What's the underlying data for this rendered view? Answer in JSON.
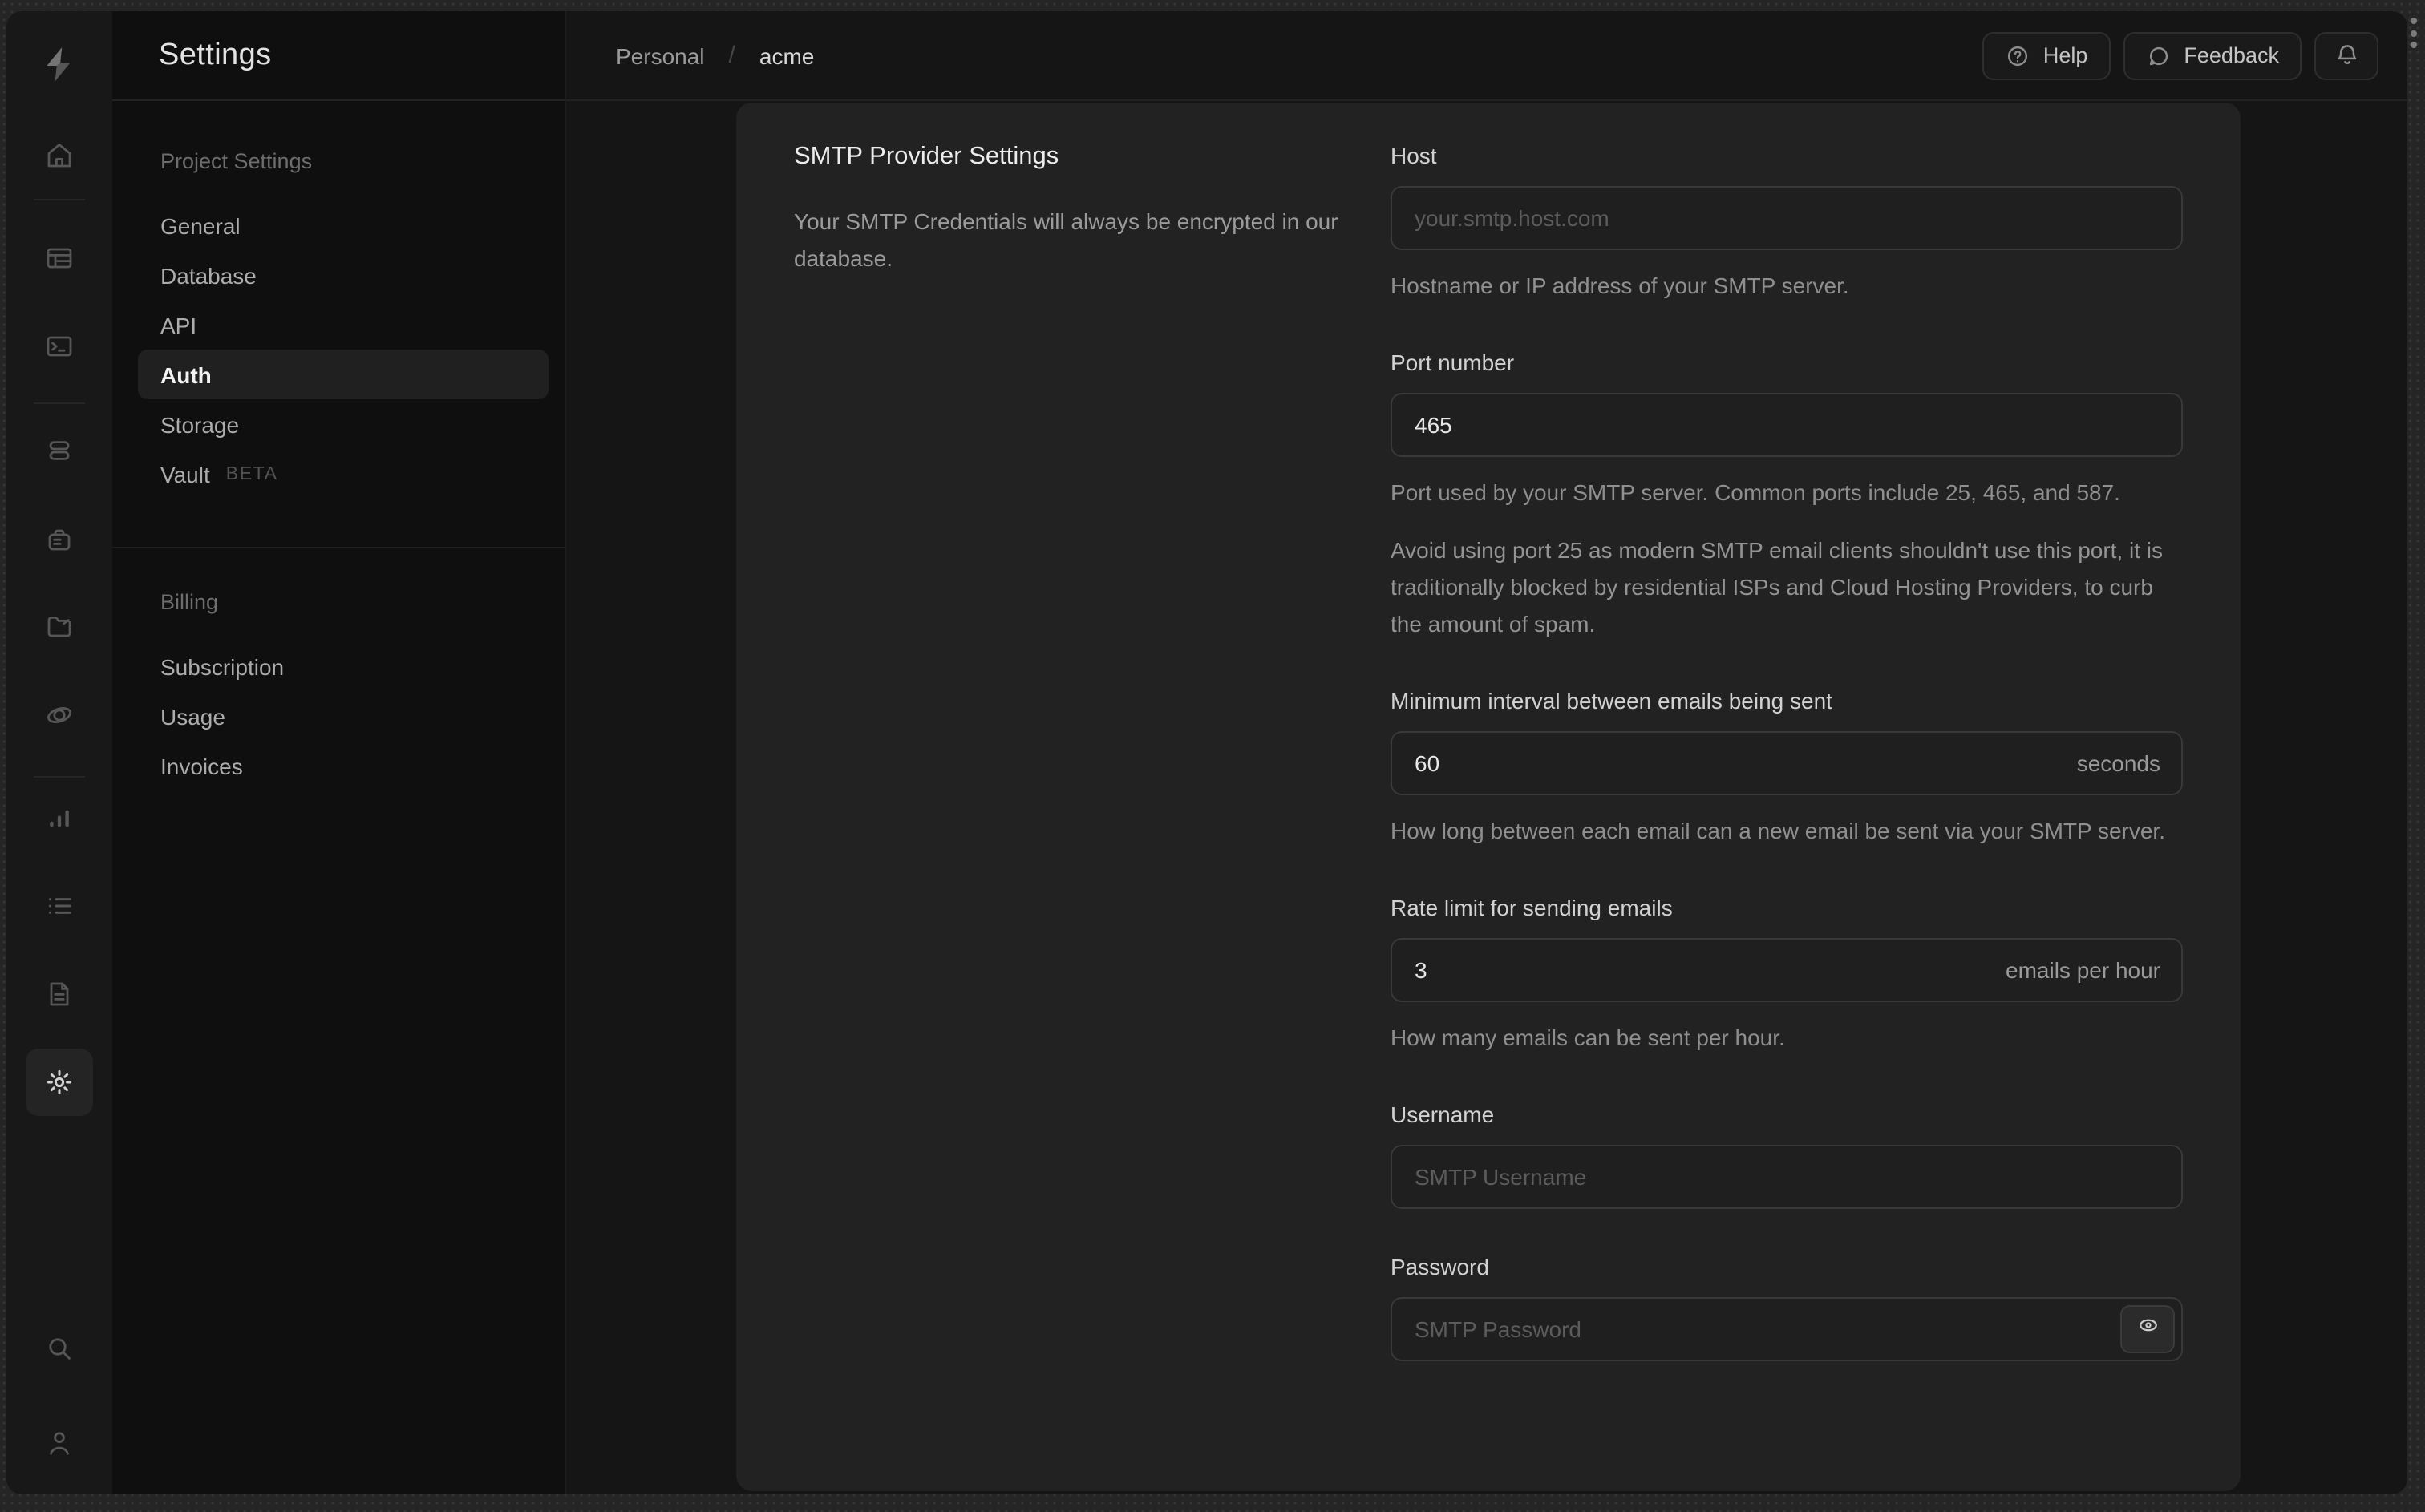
{
  "topbar": {
    "breadcrumb": {
      "org": "Personal",
      "separator": "/",
      "project": "acme"
    },
    "help": "Help",
    "feedback": "Feedback"
  },
  "menu": {
    "title": "Settings",
    "sections": [
      {
        "header": "Project Settings",
        "items": [
          {
            "label": "General"
          },
          {
            "label": "Database"
          },
          {
            "label": "API"
          },
          {
            "label": "Auth",
            "active": true
          },
          {
            "label": "Storage"
          },
          {
            "label": "Vault",
            "badge": "BETA"
          }
        ]
      },
      {
        "header": "Billing",
        "items": [
          {
            "label": "Subscription"
          },
          {
            "label": "Usage"
          },
          {
            "label": "Invoices"
          }
        ]
      }
    ]
  },
  "sidebar_rail": {
    "icons": [
      "supabase-logo",
      "home",
      "table-editor",
      "sql-editor",
      "database",
      "auth",
      "storage",
      "edge-functions",
      "reports",
      "logs",
      "docs",
      "settings",
      "search",
      "user"
    ]
  },
  "panel": {
    "title": "SMTP Provider Settings",
    "description": "Your SMTP Credentials will always be encrypted in our database."
  },
  "form": {
    "fields": [
      {
        "label": "Host",
        "placeholder": "your.smtp.host.com",
        "helper": "Hostname or IP address of your SMTP server."
      },
      {
        "label": "Port number",
        "value": "465",
        "helper": "Port used by your SMTP server. Common ports include 25, 465, and 587.",
        "note": "Avoid using port 25 as modern SMTP email clients shouldn't use this port, it is traditionally blocked by residential ISPs and Cloud Hosting Providers, to curb the amount of spam."
      },
      {
        "label": "Minimum interval between emails being sent",
        "value": "60",
        "suffix": "seconds",
        "helper": "How long between each email can a new email be sent via your SMTP server."
      },
      {
        "label": "Rate limit for sending emails",
        "value": "3",
        "suffix": "emails per hour",
        "helper": "How many emails can be sent per hour."
      },
      {
        "label": "Username",
        "placeholder": "SMTP Username"
      },
      {
        "label": "Password",
        "placeholder": "SMTP Password"
      }
    ]
  },
  "colors": {
    "frame_bg": "#252525",
    "app_bg": "#0f0f0f",
    "card_bg": "#222222",
    "input_border": "#393939",
    "text_primary": "#ededed",
    "text_muted": "#8f8f8f"
  }
}
